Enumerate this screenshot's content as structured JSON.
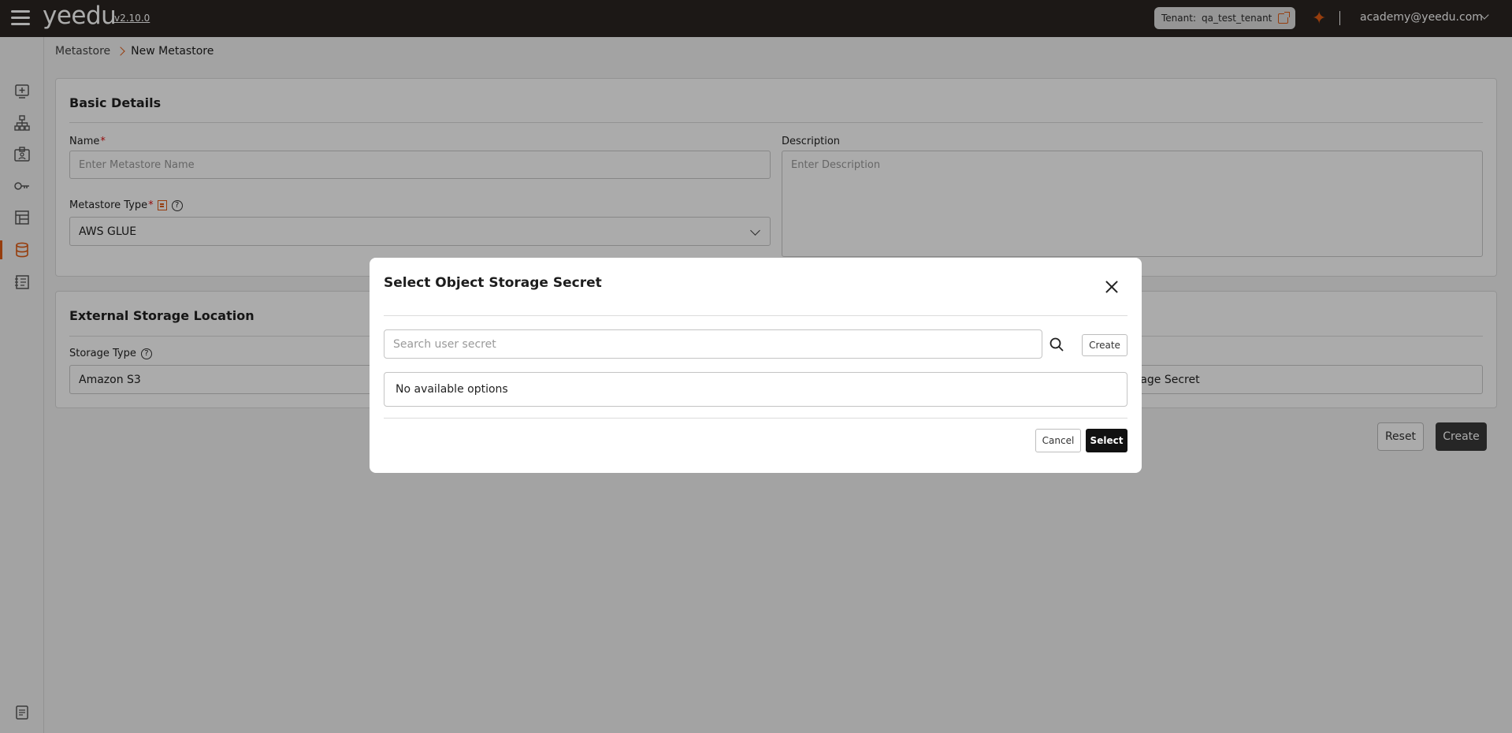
{
  "app": {
    "logo_text": "yeedu",
    "version": "v2.10.0",
    "tenant_label": "Tenant:",
    "tenant_value": "qa_test_tenant",
    "user_email": "academy@yeedu.com",
    "accent_color": "#e05b14"
  },
  "sidebar": {
    "items": [
      {
        "name": "workspace-icon",
        "active": false
      },
      {
        "name": "cluster-icon",
        "active": false
      },
      {
        "name": "id-card-icon",
        "active": false
      },
      {
        "name": "key-icon",
        "active": false
      },
      {
        "name": "board-icon",
        "active": false
      },
      {
        "name": "database-icon",
        "active": true
      },
      {
        "name": "notebook-icon",
        "active": false
      },
      {
        "name": "logs-icon",
        "active": false
      }
    ]
  },
  "breadcrumb": {
    "parent": "Metastore",
    "current": "New Metastore"
  },
  "basic_details": {
    "title": "Basic Details",
    "name_label": "Name",
    "name_placeholder": "Enter Metastore Name",
    "description_label": "Description",
    "description_placeholder": "Enter Description",
    "metastore_type_label": "Metastore Type",
    "metastore_type_value": "AWS GLUE"
  },
  "external_storage": {
    "title": "External Storage Location",
    "storage_type_label": "Storage Type",
    "storage_type_value": "Amazon S3",
    "secret_partial_text": "orage Secret"
  },
  "actions": {
    "reset_label": "Reset",
    "create_label": "Create"
  },
  "modal": {
    "title": "Select Object Storage Secret",
    "search_placeholder": "Search user secret",
    "create_label": "Create",
    "empty_text": "No available options",
    "cancel_label": "Cancel",
    "select_label": "Select"
  }
}
